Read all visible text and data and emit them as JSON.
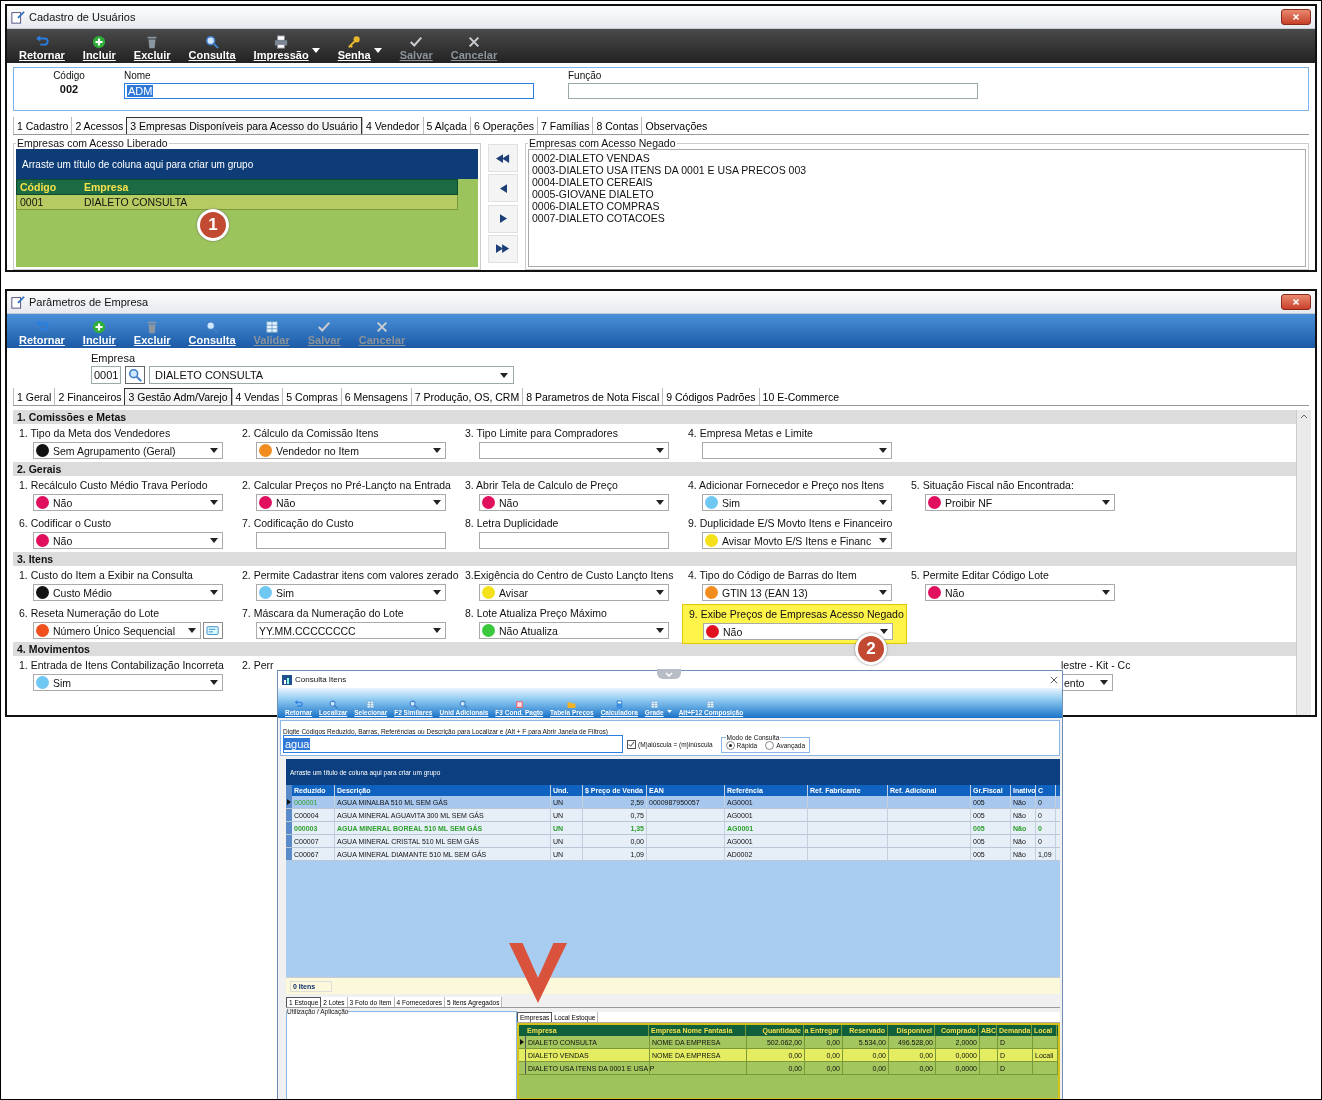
{
  "win1": {
    "title": "Cadastro de Usuários",
    "toolbar": [
      {
        "label": "Retornar",
        "disabled": false,
        "menu": false
      },
      {
        "label": "Incluir",
        "disabled": false,
        "menu": false
      },
      {
        "label": "Excluir",
        "disabled": false,
        "menu": false
      },
      {
        "label": "Consulta",
        "disabled": false,
        "menu": false
      },
      {
        "label": "Impressão",
        "disabled": false,
        "menu": true
      },
      {
        "label": "Senha",
        "disabled": false,
        "menu": true
      },
      {
        "label": "Salvar",
        "disabled": true,
        "menu": false
      },
      {
        "label": "Cancelar",
        "disabled": true,
        "menu": false
      }
    ],
    "code": {
      "label": "Código",
      "value": "002"
    },
    "name": {
      "label": "Nome",
      "value": "ADM"
    },
    "function": {
      "label": "Função"
    },
    "tabs": [
      {
        "label": "1 Cadastro",
        "selected": false
      },
      {
        "label": "2 Acessos",
        "selected": false
      },
      {
        "label": "3 Empresas Disponíveis para Acesso do Usuário",
        "selected": true
      },
      {
        "label": "4 Vendedor",
        "selected": false
      },
      {
        "label": "5 Alçada",
        "selected": false
      },
      {
        "label": "6 Operações",
        "selected": false
      },
      {
        "label": "7 Famílias",
        "selected": false
      },
      {
        "label": "8 Contas",
        "selected": false
      },
      {
        "label": "Observações",
        "selected": false
      }
    ],
    "allowed": {
      "legend": "Empresas com Acesso Liberado",
      "group_hint": "Arraste um título de coluna aqui para criar um grupo",
      "columns": [
        "Código",
        "Empresa"
      ],
      "rows": [
        [
          "0001",
          "DIALETO CONSULTA"
        ]
      ]
    },
    "denied": {
      "legend": "Empresas com Acesso Negado",
      "items": [
        "0002-DIALETO VENDAS",
        "0003-DIALETO USA ITENS DA 0001 E USA PRECOS 003",
        "0004-DIALETO CEREAIS",
        "0005-GIOVANE DIALETO",
        "0006-DIALETO COMPRAS",
        "0007-DIALETO COTACOES"
      ]
    },
    "callout": "1"
  },
  "win2": {
    "title": "Parâmetros de Empresa",
    "toolbar": [
      {
        "label": "Retornar",
        "disabled": false
      },
      {
        "label": "Incluir",
        "disabled": false
      },
      {
        "label": "Excluir",
        "disabled": false
      },
      {
        "label": "Consulta",
        "disabled": false
      },
      {
        "label": "Validar",
        "disabled": true
      },
      {
        "label": "Salvar",
        "disabled": true
      },
      {
        "label": "Cancelar",
        "disabled": true
      }
    ],
    "company": {
      "label": "Empresa",
      "code": "0001",
      "name": "DIALETO CONSULTA"
    },
    "tabs": [
      {
        "label": "1 Geral",
        "selected": false
      },
      {
        "label": "2 Financeiros",
        "selected": false
      },
      {
        "label": "3 Gestão Adm/Varejo",
        "selected": true
      },
      {
        "label": "4 Vendas",
        "selected": false
      },
      {
        "label": "5 Compras",
        "selected": false
      },
      {
        "label": "6 Mensagens",
        "selected": false
      },
      {
        "label": "7 Produção, OS, CRM",
        "selected": false
      },
      {
        "label": "8 Parametros de Nota Fiscal",
        "selected": false
      },
      {
        "label": "9 Códigos Padrões",
        "selected": false
      },
      {
        "label": "10 E-Commerce",
        "selected": false
      }
    ],
    "sections": [
      {
        "title": "1. Comissões e Metas",
        "rows": [
          [
            {
              "kind": "select",
              "label": "1. Tipo da Meta dos Vendedores",
              "value": "Sem Agrupamento (Geral)",
              "color": "#111111"
            },
            {
              "kind": "select",
              "label": "2. Cálculo da Comissão Itens",
              "value": "Vendedor no Item",
              "color": "#f28c1e"
            },
            {
              "kind": "select",
              "label": "3. Tipo Limite para Compradores"
            },
            {
              "kind": "select",
              "label": "4. Empresa Metas e Limite"
            }
          ]
        ]
      },
      {
        "title": "2. Gerais",
        "rows": [
          [
            {
              "kind": "select",
              "label": "1. Recálculo Custo Médio Trava Período",
              "value": "Não",
              "color": "#e0105e"
            },
            {
              "kind": "select",
              "label": "2. Calcular Preços no Pré-Lançto na Entrada",
              "value": "Não",
              "color": "#e0105e"
            },
            {
              "kind": "select",
              "label": "3. Abrir Tela de Calculo de Preço",
              "value": "Não",
              "color": "#e0105e"
            },
            {
              "kind": "select",
              "label": "4. Adicionar Fornecedor e Preço nos Itens",
              "value": "Sim",
              "color": "#6ec8f2"
            },
            {
              "kind": "select",
              "label": "5. Situação Fiscal não Encontrada:",
              "value": "Proibir NF",
              "color": "#e0105e"
            }
          ],
          [
            {
              "kind": "select",
              "label": "6. Codificar o Custo",
              "value": "Não",
              "color": "#e0105e"
            },
            {
              "kind": "text",
              "label": "7. Codificação do Custo"
            },
            {
              "kind": "text",
              "label": "8. Letra Duplicidade"
            },
            {
              "kind": "select",
              "label": "9. Duplicidade E/S Movto Itens e Financeiro",
              "value": "Avisar Movto E/S Itens e Financ",
              "color": "#f5e11a"
            }
          ]
        ]
      },
      {
        "title": "3. Itens",
        "rows": [
          [
            {
              "kind": "select",
              "label": "1. Custo do Item a Exibir na Consulta",
              "value": "Custo Médio",
              "color": "#111111"
            },
            {
              "kind": "select",
              "label": "2. Permite Cadastrar itens com valores zerado",
              "value": "Sim",
              "color": "#6ec8f2"
            },
            {
              "kind": "select",
              "label": "3.Exigência do Centro de Custo Lançto Itens",
              "value": "Avisar",
              "color": "#f5e11a"
            },
            {
              "kind": "select",
              "label": "4. Tipo do Código de Barras do Item",
              "value": "GTIN 13 (EAN 13)",
              "color": "#f28c1e"
            },
            {
              "kind": "select",
              "label": "5. Permite Editar Código Lote",
              "value": "Não",
              "color": "#e0105e"
            }
          ],
          [
            {
              "kind": "select",
              "label": "6. Reseta Numeração do Lote",
              "value": "Número Único Sequencial",
              "color": "#f0501e",
              "extra_button": true
            },
            {
              "kind": "select",
              "label": "7. Máscara da Numeração do Lote",
              "value": "YY.MM.CCCCCCCC"
            },
            {
              "kind": "select",
              "label": "8. Lote Atualiza Preço Máximo",
              "value": "Não Atualiza",
              "color": "#3cc83c"
            },
            {
              "kind": "select",
              "label": "9. Exibe Preços de Empresas Acesso Negado",
              "value": "Não",
              "color": "#e0101e",
              "highlight": true
            }
          ]
        ]
      },
      {
        "title": "4. Movimentos",
        "rows": [
          [
            {
              "kind": "select",
              "label": "1. Entrada de Itens Contabilização Incorreta",
              "value": "Sim",
              "color": "#6ec8f2"
            },
            {
              "kind": "cut",
              "label": "2. Perr"
            },
            {
              "kind": "partial",
              "label": "lestre - Kit - Cc",
              "value": "ento"
            }
          ]
        ]
      }
    ],
    "callout": "2"
  },
  "win3": {
    "title": "Consulta Itens",
    "toolbar": [
      {
        "label": "Retornar",
        "menu": false
      },
      {
        "label": "Localizar",
        "menu": false
      },
      {
        "label": "Selecionar",
        "menu": false
      },
      {
        "label": "F2 Similares",
        "menu": false
      },
      {
        "label": "Unid Adicionais",
        "menu": false
      },
      {
        "label": "F3 Cond. Pagto",
        "menu": false
      },
      {
        "label": "Tabela Preços",
        "menu": false
      },
      {
        "label": "Calculadora",
        "menu": false
      },
      {
        "label": "Grade",
        "menu": true
      },
      {
        "label": "Alt+F12 Composição",
        "menu": false
      }
    ],
    "filter": {
      "legend": "Digite Códigos Reduzido, Barras, Referências ou Descrição para Localizar e (Alt + F para Abrir Janela de Filtros)",
      "value": "agua"
    },
    "case_option": {
      "label": "(M)aiúscula = (m)inúscula",
      "checked": true
    },
    "mode": {
      "legend": "Modo de Consulta",
      "options": [
        {
          "label": "Rápida",
          "selected": true
        },
        {
          "label": "Avançada",
          "selected": false
        }
      ]
    },
    "items": {
      "group_hint": "Arraste um título de coluna aqui para criar um grupo",
      "columns": [
        "Reduzido",
        "Descrição",
        "Und.",
        "$ Preço de Venda",
        "EAN",
        "Referência",
        "Ref. Fabricante",
        "Ref. Adicional",
        "Gr.Fiscal",
        "Inativo",
        "C"
      ],
      "rows": [
        {
          "selected": true,
          "kind": "code",
          "cells": [
            "000001",
            "AGUA MINALBA 510 ML SEM GÁS",
            "UN",
            "2,59",
            "0000987950057",
            "AG0001",
            "",
            "",
            "005",
            "Não",
            "0"
          ]
        },
        {
          "selected": false,
          "kind": "plain",
          "cells": [
            "C00004",
            "AGUA MINERAL AGUAVITA 300 ML SEM GÁS",
            "UN",
            "0,75",
            "",
            "AG0001",
            "",
            "",
            "005",
            "Não",
            "0"
          ]
        },
        {
          "selected": false,
          "kind": "emphasis",
          "cells": [
            "000003",
            "AGUA MINERAL BOREAL 510 ML SEM GÁS",
            "UN",
            "1,35",
            "",
            "AG0001",
            "",
            "",
            "005",
            "Não",
            "0"
          ]
        },
        {
          "selected": false,
          "kind": "plain",
          "cells": [
            "C00007",
            "AGUA MINERAL CRISTAL 510 ML SEM GÁS",
            "UN",
            "0,00",
            "",
            "AG0001",
            "",
            "",
            "005",
            "Não",
            "0"
          ]
        },
        {
          "selected": false,
          "kind": "plain",
          "cells": [
            "C00067",
            "AGUA MINERAL DIAMANTE 510 ML SEM GÁS",
            "UN",
            "1,09",
            "",
            "AD0002",
            "",
            "",
            "005",
            "Não",
            "1,09"
          ]
        }
      ]
    },
    "count": "0 Itens",
    "tabs": [
      {
        "label": "1 Estoque",
        "selected": true
      },
      {
        "label": "2 Lotes",
        "selected": false
      },
      {
        "label": "3 Foto do Item",
        "selected": false
      },
      {
        "label": "4 Fornecedores",
        "selected": false
      },
      {
        "label": "5 Itens Agregados",
        "selected": false
      }
    ],
    "usage": {
      "legend": "Utilização / Aplicação"
    },
    "stock": {
      "tabs": [
        {
          "label": "Empresas",
          "selected": true
        },
        {
          "label": "Local Estoque",
          "selected": false
        }
      ],
      "columns": [
        "Empresa",
        "Empresa Nome Fantasia",
        "Quantidade",
        "a Entregar",
        "Reservado",
        "Disponível",
        "Comprado",
        "ABC",
        "Demanda",
        "Local"
      ],
      "rows": [
        {
          "selected": true,
          "cells": [
            "DIALETO CONSULTA",
            "NOME DA EMPRESA",
            "502.062,00",
            "0,00",
            "5.534,00",
            "496.528,00",
            "2,0000",
            "",
            "D",
            ""
          ]
        },
        {
          "selected": false,
          "cells": [
            "DIALETO VENDAS",
            "NOME DA EMPRESA",
            "0,00",
            "0,00",
            "0,00",
            "0,00",
            "0,0000",
            "",
            "D",
            "Locali"
          ]
        },
        {
          "selected": false,
          "cells": [
            "DIALETO USA ITENS DA 0001 E USA P",
            "",
            "0,00",
            "0,00",
            "0,00",
            "0,00",
            "0,0000",
            "",
            "D",
            ""
          ]
        }
      ]
    }
  }
}
